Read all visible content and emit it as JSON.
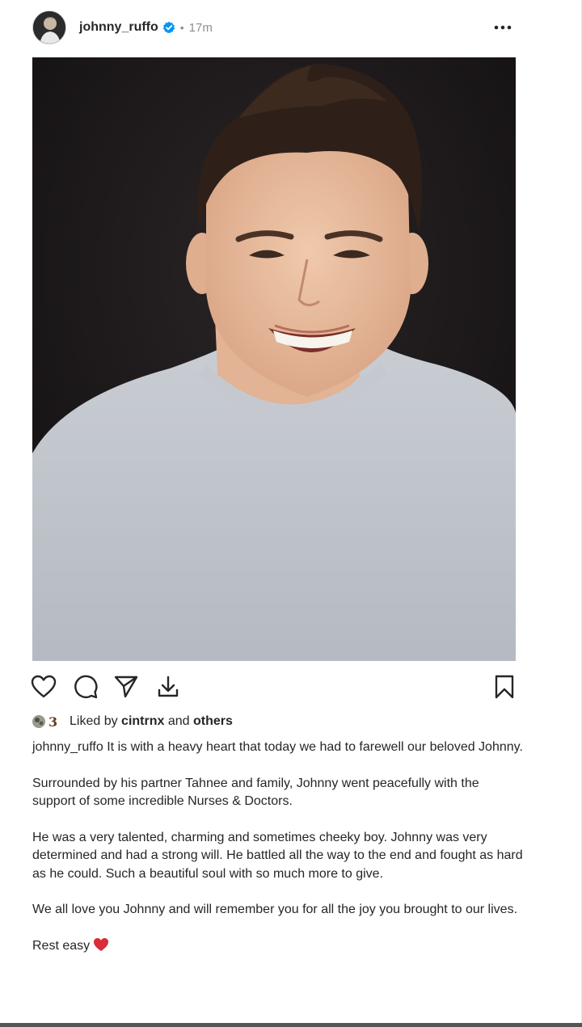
{
  "post": {
    "username": "johnny_ruffo",
    "separator": "•",
    "time": "17m",
    "verified": true,
    "more_icon": "more-horizontal-icon",
    "photo_alt": "",
    "actions": {
      "like_icon": "heart-outline-icon",
      "comment_icon": "comment-icon",
      "share_icon": "send-icon",
      "download_icon": "download-icon",
      "save_icon": "bookmark-icon"
    },
    "likes": {
      "prefix": "Liked by",
      "user": "cintrnx",
      "and": "and",
      "others": "others"
    },
    "caption": {
      "author": "johnny_ruffo",
      "p1": "It is with a heavy heart that today we had to farewell our beloved Johnny.",
      "p2": "Surrounded by his partner Tahnee and family, Johnny went peacefully with the support of some incredible Nurses & Doctors.",
      "p3": "He was a very talented, charming and sometimes cheeky boy. Johnny was very determined and had a strong will. He battled all the way to the end and fought as hard as he could. Such a beautiful soul with so much more to give.",
      "p4": "We all love you Johnny and will remember you for all the joy you brought to our lives.",
      "p5": "Rest easy"
    },
    "colors": {
      "verified": "#0095f6",
      "heart_emoji": "#d92b3a",
      "photo_background": "#1b1819"
    }
  }
}
